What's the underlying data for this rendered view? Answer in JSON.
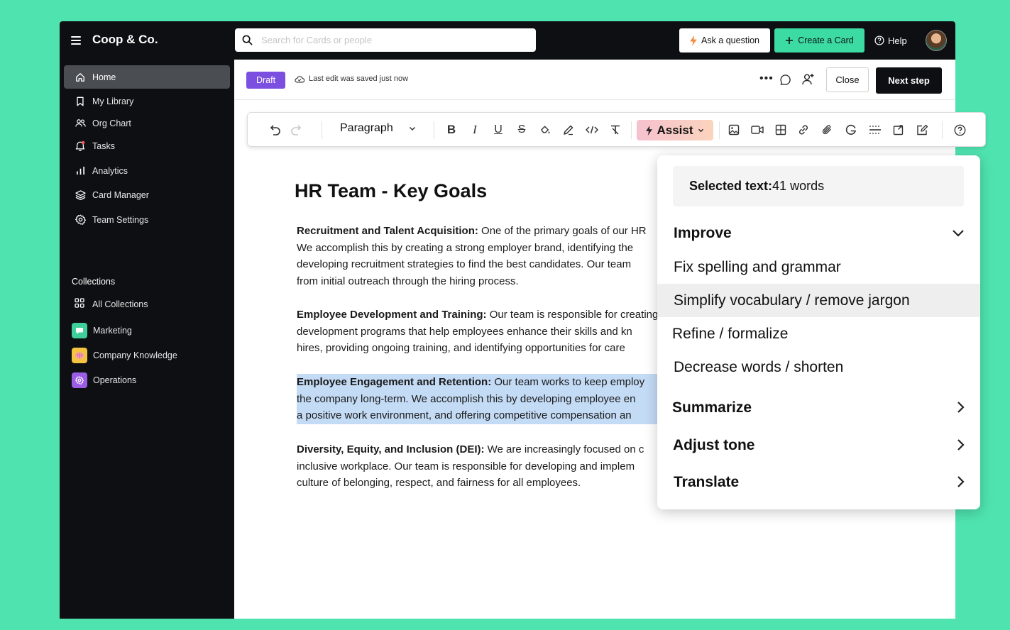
{
  "app": {
    "brand": "Coop & Co."
  },
  "topbar": {
    "search_placeholder": "Search for Cards or people",
    "ask_label": "Ask a question",
    "create_label": "Create a Card",
    "help_label": "Help"
  },
  "sidebar": {
    "items": [
      {
        "label": "Home",
        "icon": "home-icon"
      },
      {
        "label": "My Library",
        "icon": "bookmark-icon"
      },
      {
        "label": "Org Chart",
        "icon": "people-icon"
      },
      {
        "label": "Tasks",
        "icon": "bell-icon"
      },
      {
        "label": "Analytics",
        "icon": "bar-chart-icon"
      },
      {
        "label": "Card Manager",
        "icon": "layers-icon"
      },
      {
        "label": "Team Settings",
        "icon": "gear-icon"
      }
    ],
    "collections_label": "Collections",
    "collections": [
      {
        "label": "All Collections",
        "icon": "grid-icon"
      },
      {
        "label": "Marketing",
        "icon": "chat-icon",
        "color": "#3ecf9a"
      },
      {
        "label": "Company Knowledge",
        "icon": "brain-icon",
        "color": "#f5c542"
      },
      {
        "label": "Operations",
        "icon": "gear-icon",
        "color": "#9b5de5"
      }
    ]
  },
  "editor": {
    "status_badge": "Draft",
    "saved_text": "Last edit was saved just now",
    "close_label": "Close",
    "next_label": "Next step"
  },
  "toolbar": {
    "paragraph_label": "Paragraph",
    "assist_label": "Assist"
  },
  "document": {
    "title": "HR Team - Key Goals",
    "p1": {
      "bold": "Recruitment and Talent Acquisition:",
      "line1": " One of the primary goals of our HR",
      "line2": "We accomplish this by creating a strong employer brand, identifying the",
      "line3": "developing recruitment strategies to find the best candidates. Our team",
      "line4": "from initial outreach through the hiring process."
    },
    "p2": {
      "bold": "Employee Development and Training:",
      "line1": " Our team is responsible for creating",
      "line2": "development programs that help employees enhance their skills and kn",
      "line3": "hires, providing ongoing training, and identifying opportunities for care"
    },
    "p3": {
      "bold": "Employee Engagement and Retention:",
      "line1": " Our team works to keep employ",
      "line2": "the company long-term. We accomplish this by developing employee en",
      "line3": "a positive work environment, and offering competitive compensation an"
    },
    "p4": {
      "bold": "Diversity, Equity, and Inclusion (DEI):",
      "line1": " We are increasingly focused on c",
      "line2": "inclusive workplace. Our team is responsible for developing and implem",
      "line3": "culture of belonging, respect, and fairness for all employees."
    }
  },
  "assist_menu": {
    "selected_label": "Selected text:",
    "selected_count": " 41 words",
    "improve_label": "Improve",
    "improve_options": [
      "Fix spelling and grammar",
      "Simplify vocabulary / remove jargon",
      "Refine / formalize",
      "Decrease words / shorten"
    ],
    "summarize_label": "Summarize",
    "tone_label": "Adjust tone",
    "translate_label": "Translate"
  },
  "colors": {
    "background": "#4fe3b0",
    "accent_green": "#3ddba4",
    "draft_purple": "#7b4fe0",
    "selection": "#c4dbf5"
  }
}
